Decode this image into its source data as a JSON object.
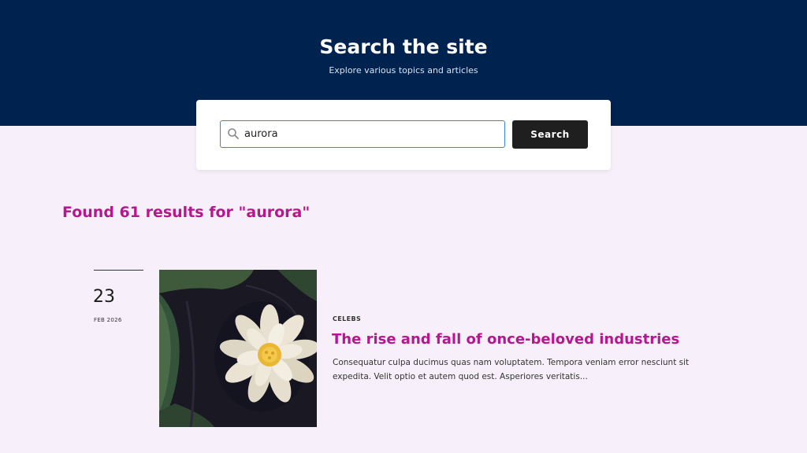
{
  "hero": {
    "title": "Search the site",
    "subtitle": "Explore various topics and articles"
  },
  "search": {
    "value": "aurora",
    "icon": "search-icon",
    "button_label": "Search"
  },
  "results": {
    "heading": "Found 61 results for \"aurora\""
  },
  "article": {
    "day": "23",
    "month_year": "FEB 2026",
    "category": "CELEBS",
    "title": "The rise and fall of once-beloved industries",
    "excerpt": "Consequatur culpa ducimus quas nam voluptatem. Tempora veniam error nesciunt sit expedita. Velit optio et autem quod est. Asperiores veritatis..."
  },
  "colors": {
    "hero_background": "#00224f",
    "accent": "#b5178f",
    "page_background": "#f7f0fa",
    "button_background": "#1f1f1f",
    "input_border": "#3a86d4"
  }
}
